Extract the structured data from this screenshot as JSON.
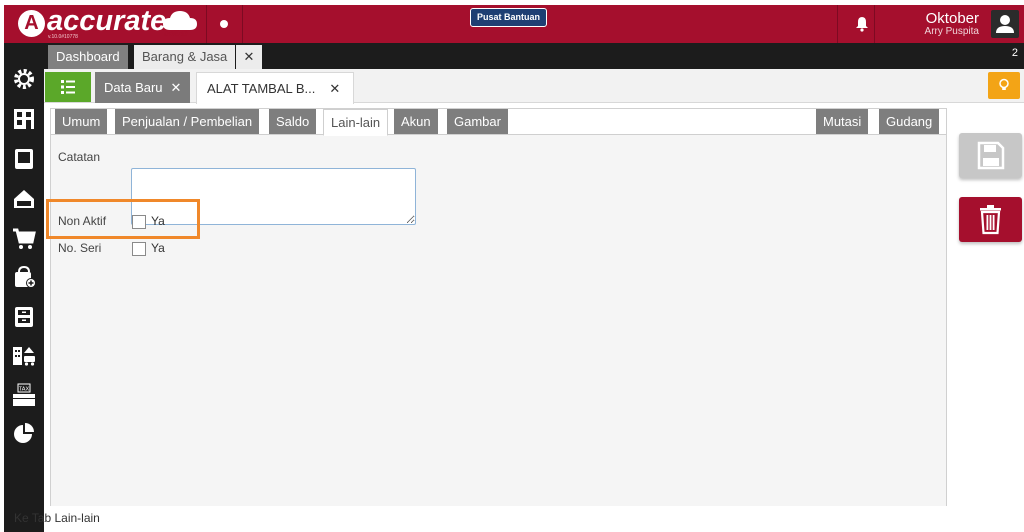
{
  "brand": {
    "mark": "A",
    "name": "accurate",
    "sub": "online",
    "version": "v.10.0#10778",
    "color": "#a50f2d"
  },
  "topbar": {
    "help_label": "Pusat Bantuan",
    "period_month": "Oktober",
    "user_name": "Arry Puspita"
  },
  "main_tabs": {
    "dashboard": "Dashboard",
    "barang_jasa": "Barang & Jasa",
    "close_symbol": "✕",
    "count": "2"
  },
  "sub_tabs": {
    "new_label": "Data Baru",
    "item_label": "ALAT TAMBAL B...",
    "close_symbol": "✕"
  },
  "form_tabs": {
    "umum": "Umum",
    "penjualan": "Penjualan / Pembelian",
    "saldo": "Saldo",
    "lain": "Lain-lain",
    "akun": "Akun",
    "gambar": "Gambar",
    "mutasi": "Mutasi",
    "gudang": "Gudang",
    "active": "Lain-lain"
  },
  "form": {
    "catatan_label": "Catatan",
    "catatan_value": "",
    "non_aktif_label": "Non Aktif",
    "non_aktif_option": "Ya",
    "non_aktif_checked": false,
    "no_seri_label": "No. Seri",
    "no_seri_option": "Ya",
    "no_seri_checked": false
  },
  "sidebar_icons": [
    "settings-icon",
    "company-icon",
    "ledger-icon",
    "cash-bank-icon",
    "sales-cart-icon",
    "purchase-bag-icon",
    "inventory-icon",
    "fixed-asset-icon",
    "tax-icon",
    "report-pie-icon"
  ],
  "status": {
    "hint": "Ke Tab Lain-lain"
  },
  "colors": {
    "topbar": "#a50f2d",
    "sidebar": "#1c1c1c",
    "list_button": "#5ba829",
    "tips_button": "#f3a416",
    "highlight": "#f0882a",
    "delete_button": "#a50f2d"
  }
}
